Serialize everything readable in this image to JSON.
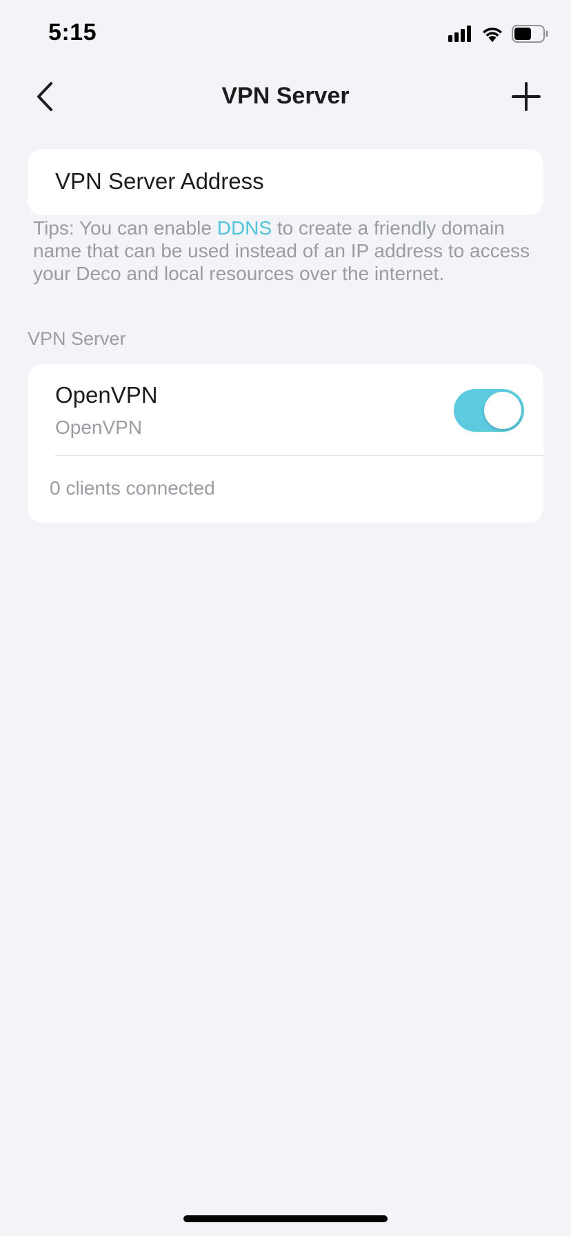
{
  "status_bar": {
    "time": "5:15",
    "icons": [
      "signal-icon",
      "wifi-icon",
      "battery-icon"
    ]
  },
  "nav": {
    "title": "VPN Server",
    "back_icon": "chevron-left-icon",
    "add_icon": "plus-icon"
  },
  "address": {
    "label": "VPN Server Address"
  },
  "tips": {
    "prefix": "Tips: You can enable ",
    "link": "DDNS",
    "suffix": " to create a friendly domain name that can be used instead of an IP address to access your Deco and local resources over the internet."
  },
  "section": {
    "header": "VPN Server"
  },
  "server": {
    "name": "OpenVPN",
    "type": "OpenVPN",
    "enabled": true,
    "clients": "0 clients connected"
  },
  "colors": {
    "accent": "#5ccbe0",
    "link": "#4ec3da",
    "background": "#f3f4f8",
    "secondary_text": "#9a9ca3"
  }
}
